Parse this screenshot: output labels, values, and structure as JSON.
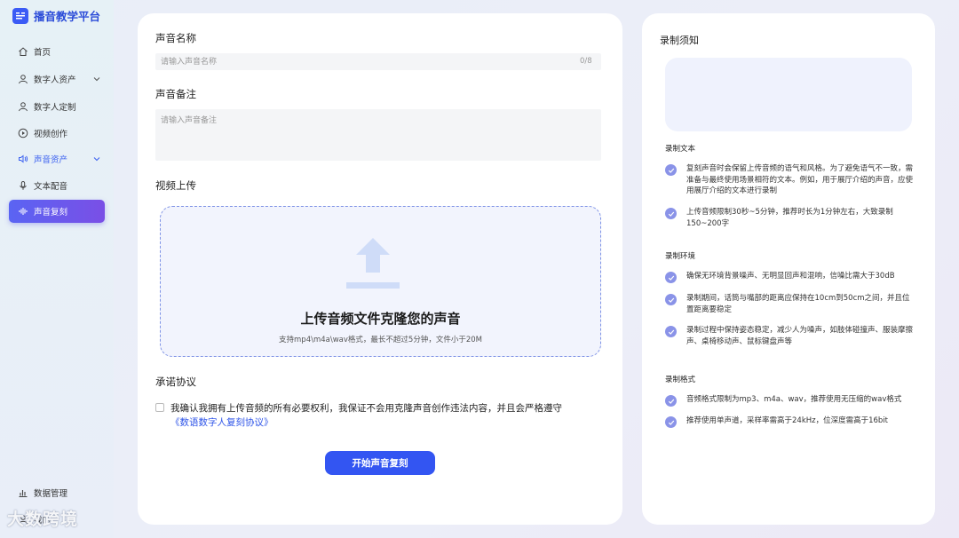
{
  "sidebar": {
    "brand": "播音教学平台",
    "items": [
      {
        "label": "首页"
      },
      {
        "label": "数字人资产"
      },
      {
        "label": "数字人定制"
      },
      {
        "label": "视频创作"
      },
      {
        "label": "声音资产"
      },
      {
        "label": "文本配音"
      },
      {
        "label": "声音复刻"
      }
    ],
    "bottom_items": [
      {
        "label": "数据管理"
      },
      {
        "label": "我的"
      }
    ],
    "watermark": "大数跨境"
  },
  "form": {
    "name_label": "声音名称",
    "name_placeholder": "请输入声音名称",
    "name_counter": "0/8",
    "note_label": "声音备注",
    "note_placeholder": "请输入声音备注",
    "upload_label": "视频上传",
    "upload_title": "上传音频文件克隆您的声音",
    "upload_hint": "支持mp4\\m4a\\wav格式，最长不超过5分钟，文件小于20M",
    "agreement_label": "承诺协议",
    "agreement_text": "我确认我拥有上传音频的所有必要权利，我保证不会用克隆声音创作违法内容，并且会严格遵守",
    "agreement_link": "《数语数字人复刻协议》",
    "agreement_checked": false,
    "submit_label": "开始声音复刻"
  },
  "notes": {
    "title": "录制须知",
    "sections": [
      {
        "heading": "录制文本",
        "rules": [
          "复刻声音时会保留上传音频的语气和风格。为了避免语气不一致，需准备与最终使用场景相符的文本。例如，用于展厅介绍的声音，应使用展厅介绍的文本进行录制",
          "上传音频限制30秒~5分钟，推荐时长为1分钟左右，大致录制150~200字"
        ]
      },
      {
        "heading": "录制环境",
        "rules": [
          "确保无环境背景噪声、无明显回声和混响，信噪比需大于30dB",
          "录制期间，话筒与嘴部的距离应保持在10cm到50cm之间，并且位置距离要稳定",
          "录制过程中保持姿态稳定，减少人为噪声，如肢体碰撞声、服装摩擦声、桌椅移动声、鼠标键盘声等"
        ]
      },
      {
        "heading": "录制格式",
        "rules": [
          "音频格式限制为mp3、m4a、wav，推荐使用无压缩的wav格式",
          "推荐使用单声道，采样率需高于24kHz，位深度需高于16bit"
        ]
      }
    ]
  },
  "colors": {
    "accent": "#3355f2",
    "active_nav_start": "#5a64f3",
    "active_nav_end": "#7a4fe6",
    "check": "#8a93e8"
  }
}
